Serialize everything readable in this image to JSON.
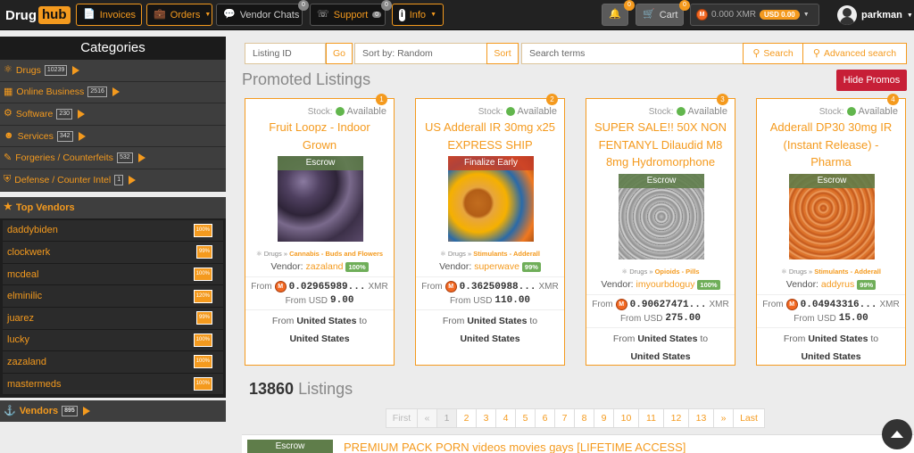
{
  "brand": {
    "part1": "Drug",
    "part2": "hub"
  },
  "nav": {
    "invoices": "Invoices",
    "orders": "Orders",
    "vendor_chats": "Vendor Chats",
    "vendor_chats_badge": "0",
    "support": "Support",
    "support_badge": "0",
    "support_badge2": "0",
    "info": "Info",
    "notif_badge": "0",
    "cart": "Cart",
    "cart_badge": "0",
    "balance_xmr": "0.000 XMR",
    "balance_usd": "USD 0.00",
    "username": "parkman"
  },
  "sidebar": {
    "title": "Categories",
    "categories": [
      {
        "label": "Drugs",
        "count": "10239"
      },
      {
        "label": "Online Business",
        "count": "2516"
      },
      {
        "label": "Software",
        "count": "230"
      },
      {
        "label": "Services",
        "count": "342"
      },
      {
        "label": "Forgeries / Counterfeits",
        "count": "532"
      },
      {
        "label": "Defense / Counter Intel",
        "count": "1"
      }
    ],
    "top_vendors_title": "Top Vendors",
    "top_vendors": [
      {
        "name": "daddybiden",
        "pct": "100%"
      },
      {
        "name": "clockwerk",
        "pct": "99%"
      },
      {
        "name": "mcdeal",
        "pct": "100%"
      },
      {
        "name": "elminilic",
        "pct": "120%"
      },
      {
        "name": "juarez",
        "pct": "99%"
      },
      {
        "name": "lucky",
        "pct": "100%"
      },
      {
        "name": "zazaland",
        "pct": "100%"
      },
      {
        "name": "mastermeds",
        "pct": "100%"
      }
    ],
    "vendors_label": "Vendors",
    "vendors_count": "895"
  },
  "search": {
    "listing_id_placeholder": "Listing ID",
    "go": "Go",
    "sort_placeholder": "Sort by: Random",
    "sort": "Sort",
    "terms_placeholder": "Search terms",
    "search": "Search",
    "advanced": "Advanced search"
  },
  "promoted": {
    "title": "Promoted Listings",
    "hide_button": "Hide Promos",
    "stock_label": "Stock:",
    "available": "Available",
    "vendor_label": "Vendor:",
    "from_label": "From",
    "usd_label": "USD",
    "xmr_label": "XMR",
    "ship_from": "From",
    "ship_to": "to",
    "cards": [
      {
        "num": "1",
        "title": "Fruit Loopz - Indoor Grown",
        "ribbon": "Escrow",
        "cat": "Drugs",
        "sub": "Cannabis - Buds and Flowers",
        "vendor": "zazaland",
        "rating": "100%",
        "xmr": "0.02965989...",
        "usd": "9.00",
        "from": "United States",
        "to": "United States"
      },
      {
        "num": "2",
        "title": "US Adderall IR 30mg x25 EXPRESS SHIP",
        "ribbon": "Finalize Early",
        "cat": "Drugs",
        "sub": "Stimulants - Adderall",
        "vendor": "superwave",
        "rating": "99%",
        "xmr": "0.36250988...",
        "usd": "110.00",
        "from": "United States",
        "to": "United States"
      },
      {
        "num": "3",
        "title": "SUPER SALE!! 50X NON FENTANYL Dilaudid M8 8mg Hydromorphone",
        "ribbon": "Escrow",
        "cat": "Drugs",
        "sub": "Opioids - Pills",
        "vendor": "imyourbdoguy",
        "rating": "100%",
        "xmr": "0.90627471...",
        "usd": "275.00",
        "from": "United States",
        "to": "United States"
      },
      {
        "num": "4",
        "title": "Adderall DP30 30mg IR (Instant Release) - Pharma",
        "ribbon": "Escrow",
        "cat": "Drugs",
        "sub": "Stimulants - Adderall",
        "vendor": "addyrus",
        "rating": "99%",
        "xmr": "0.04943316...",
        "usd": "15.00",
        "from": "United States",
        "to": "United States"
      }
    ]
  },
  "listings": {
    "count": "13860",
    "label": "Listings",
    "pages": [
      "First",
      "«",
      "1",
      "2",
      "3",
      "4",
      "5",
      "6",
      "7",
      "8",
      "9",
      "10",
      "11",
      "12",
      "13",
      "»",
      "Last"
    ],
    "first_row": {
      "ribbon": "Escrow",
      "title": "PREMIUM PACK PORN videos movies gays [LIFETIME ACCESS]"
    }
  },
  "icons": [
    "file-icon",
    "briefcase-icon",
    "chat-icon",
    "headset-icon",
    "info-icon",
    "bell-icon",
    "cart-icon",
    "monero-icon",
    "leaf-icon",
    "building-icon",
    "cog-icon",
    "user-group-icon",
    "pen-icon",
    "shield-icon",
    "star-icon",
    "handshake-icon",
    "search-icon",
    "chevron-up-icon"
  ],
  "colors": {
    "accent": "#f49a1e",
    "danger": "#c71f37",
    "success": "#6fae59",
    "nav": "#222222"
  }
}
